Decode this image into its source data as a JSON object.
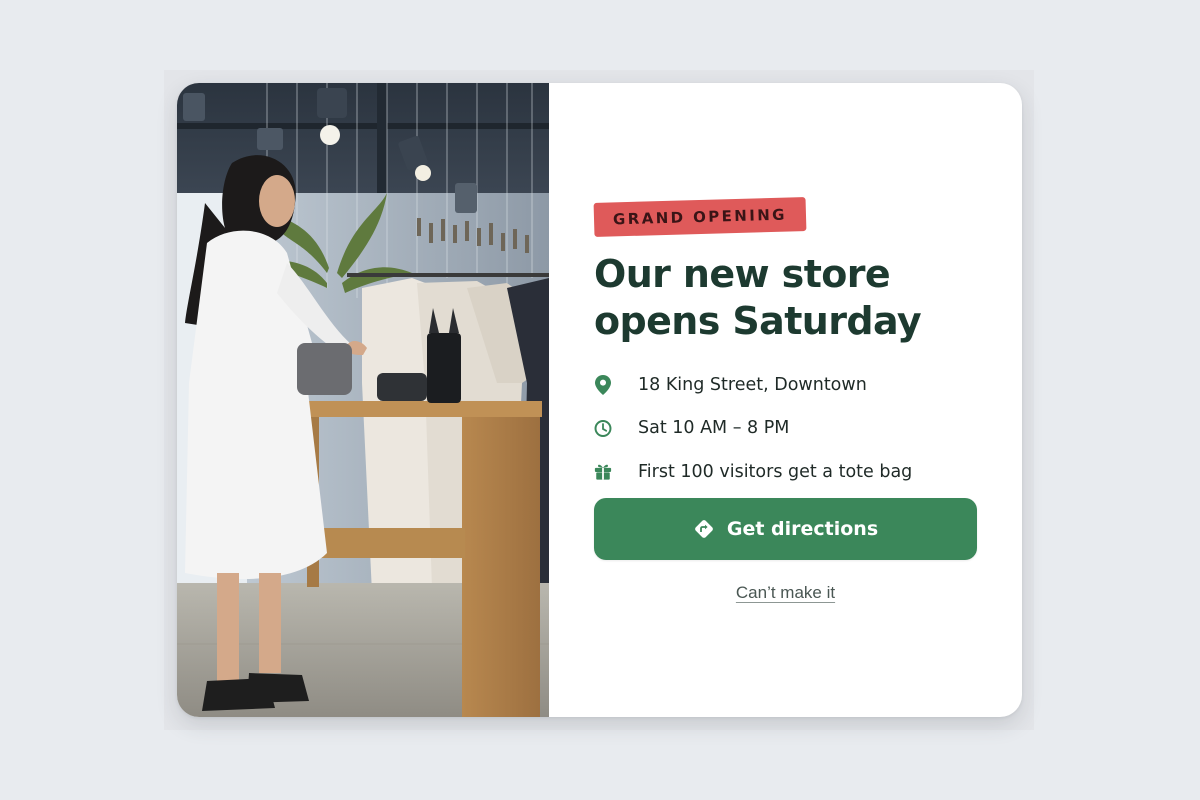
{
  "badge": "GRAND OPENING",
  "title": "Our new store opens Saturday",
  "details": [
    {
      "icon": "location-pin-icon",
      "text": "18 King Street, Downtown"
    },
    {
      "icon": "clock-icon",
      "text": "Sat 10 AM – 8 PM"
    },
    {
      "icon": "gift-icon",
      "text": "First 100 visitors get a tote bag"
    }
  ],
  "primary_action": {
    "label": "Get directions",
    "icon": "directions-icon"
  },
  "secondary_action": {
    "label": "Can’t make it"
  },
  "colors": {
    "accent_green": "#3b875a",
    "badge_red": "#df5a5a",
    "title_dark_green": "#1d3a30",
    "page_background": "#e8ebef"
  }
}
